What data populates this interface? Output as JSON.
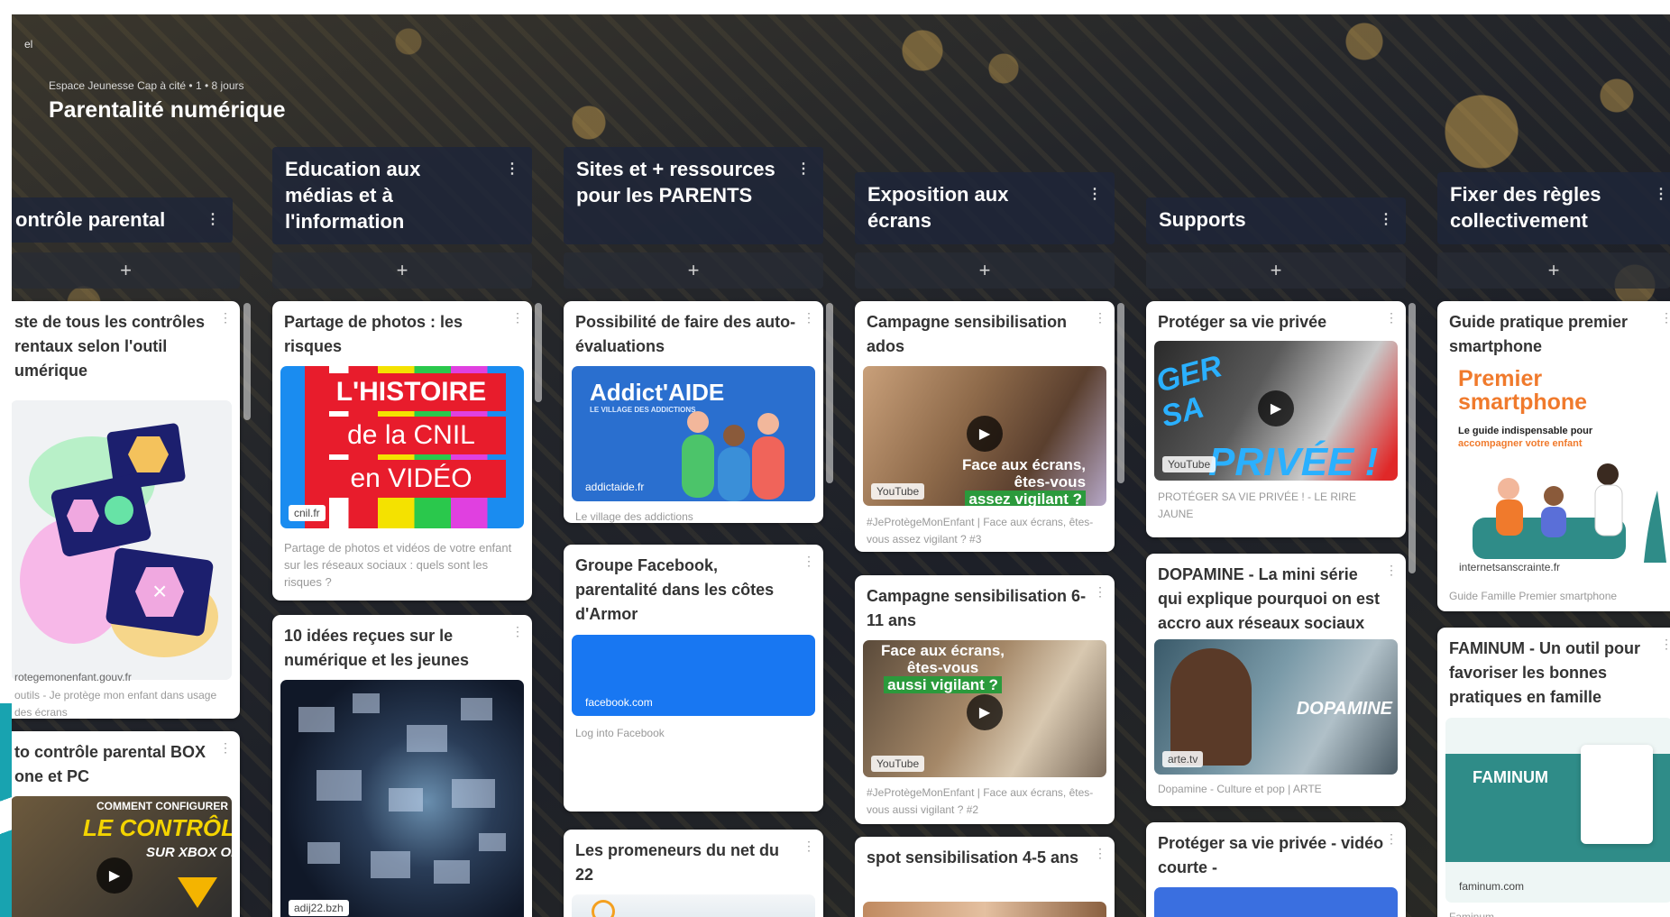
{
  "board": {
    "corner_label": "el",
    "subtitle": "Espace Jeunesse Cap à cité • 1 • 8 jours",
    "title": "Parentalité numérique"
  },
  "columns": [
    {
      "title": "ontrôle parental"
    },
    {
      "title": "Education aux médias et à l'information"
    },
    {
      "title": "Sites et + ressources pour les PARENTS"
    },
    {
      "title": "Exposition aux écrans"
    },
    {
      "title": "Supports"
    },
    {
      "title": "Fixer des règles collectivement"
    }
  ],
  "ui": {
    "add": "+",
    "menu": "⋮",
    "play": "▶"
  },
  "cards": {
    "c1a": {
      "title": "ste de tous les contrôles rentaux selon l'outil umérique",
      "source": "rotegemonenfant.gouv.fr",
      "desc": "outils - Je protège mon enfant dans usage des écrans"
    },
    "c1b": {
      "title": "to contrôle parental BOX one et PC",
      "thumb_line1": "LE CONTRÔLE PAR",
      "thumb_line2": "SUR XBOX ON",
      "thumb_top": "COMMENT CONFIGURER"
    },
    "c2a": {
      "title": "Partage de photos : les risques",
      "thumb_line1": "L'HISTOIRE",
      "thumb_line2": "de la CNIL",
      "thumb_line3": "en VIDÉO",
      "source": "cnil.fr",
      "desc": "Partage de photos et vidéos de votre enfant sur les réseaux sociaux : quels sont les risques ?"
    },
    "c2b": {
      "title": "10 idées reçues sur le numérique et les jeunes",
      "source": "adij22.bzh"
    },
    "c3a": {
      "title": "Possibilité de faire des auto-évaluations",
      "thumb_line1": "Addict'AIDE",
      "thumb_line2": "LE VILLAGE DES ADDICTIONS",
      "source": "addictaide.fr",
      "desc": "Le village des addictions"
    },
    "c3b": {
      "title": "Groupe Facebook, parentalité dans les côtes d'Armor",
      "source": "facebook.com",
      "desc": "Log into Facebook"
    },
    "c3c": {
      "title": "Les promeneurs du net du 22"
    },
    "c4a": {
      "title": "Campagne sensibilisation ados",
      "thumb_line1": "Face aux écrans,",
      "thumb_line2": "êtes-vous",
      "thumb_line3": "assez vigilant ?",
      "source": "YouTube",
      "desc": "#JeProtègeMonEnfant | Face aux écrans, êtes-vous assez vigilant ? #3"
    },
    "c4b": {
      "title": "Campagne sensibilisation 6-11 ans",
      "thumb_line1": "Face aux écrans,",
      "thumb_line2": "êtes-vous",
      "thumb_line3": "aussi vigilant ?",
      "source": "YouTube",
      "desc": "#JeProtègeMonEnfant | Face aux écrans, êtes-vous aussi vigilant ? #2"
    },
    "c4c": {
      "title": "spot sensibilisation 4-5 ans"
    },
    "c5a": {
      "title": "Protéger sa vie privée",
      "thumb_line1": "GER",
      "thumb_line2": "SA",
      "thumb_line3": "PRIVÉE !",
      "source": "YouTube",
      "desc": "PROTÉGER SA VIE PRIVÉE ! - LE RIRE JAUNE"
    },
    "c5b": {
      "title": "DOPAMINE - La mini série qui explique pourquoi on est accro aux réseaux sociaux",
      "thumb_line1": "DOPAMINE",
      "source": "arte.tv",
      "desc": "Dopamine - Culture et pop | ARTE"
    },
    "c5c": {
      "title": "Protéger sa vie privée - vidéo courte -"
    },
    "c6a": {
      "title": "Guide pratique premier smartphone",
      "thumb_line1": "Premier",
      "thumb_line2": "smartphone",
      "thumb_line3": "Le guide indispensable pour",
      "thumb_line4": "accompagner votre enfant",
      "source": "internetsanscrainte.fr",
      "desc": "Guide Famille Premier smartphone"
    },
    "c6b": {
      "title": "FAMINUM - Un outil pour favoriser les bonnes pratiques en famille",
      "thumb_line1": "FAMINUM",
      "source": "faminum.com",
      "desc": "Faminum"
    }
  },
  "colors": {
    "facebook_blue": "#1877f2",
    "addictaide_blue": "#2a6fcf",
    "premier_orange": "#f07a2c",
    "faminum_teal": "#2f8c88",
    "header_bg": "#1e2638"
  }
}
